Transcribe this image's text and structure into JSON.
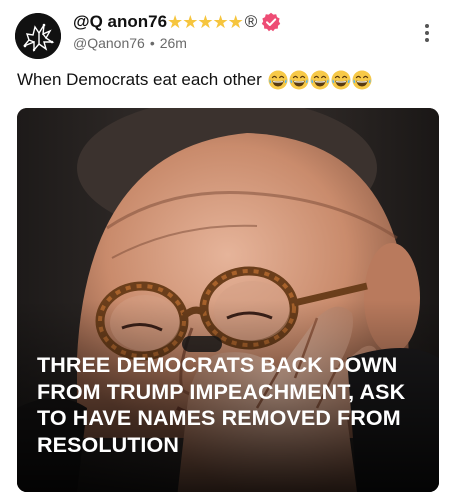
{
  "post": {
    "author": {
      "display_name": "@Q anon76",
      "star_count": 5,
      "registered_mark": "®",
      "handle": "@Qanon76",
      "separator": "•",
      "time_ago": "26m"
    },
    "text": "When Democrats eat each other",
    "emoji_count": 5,
    "media": {
      "headline": "THREE DEMOCRATS BACK DOWN FROM TRUMP IMPEACHMENT, ASK TO HAVE NAMES REMOVED FROM RESOLUTION"
    },
    "icons": [
      "star-icon",
      "verified-badge-icon",
      "more-options-icon",
      "laughing-emoji-icon"
    ],
    "colors": {
      "star": "#f6c53e",
      "verified_badge": "#ee4d75",
      "emoji": "#f7c948"
    }
  }
}
